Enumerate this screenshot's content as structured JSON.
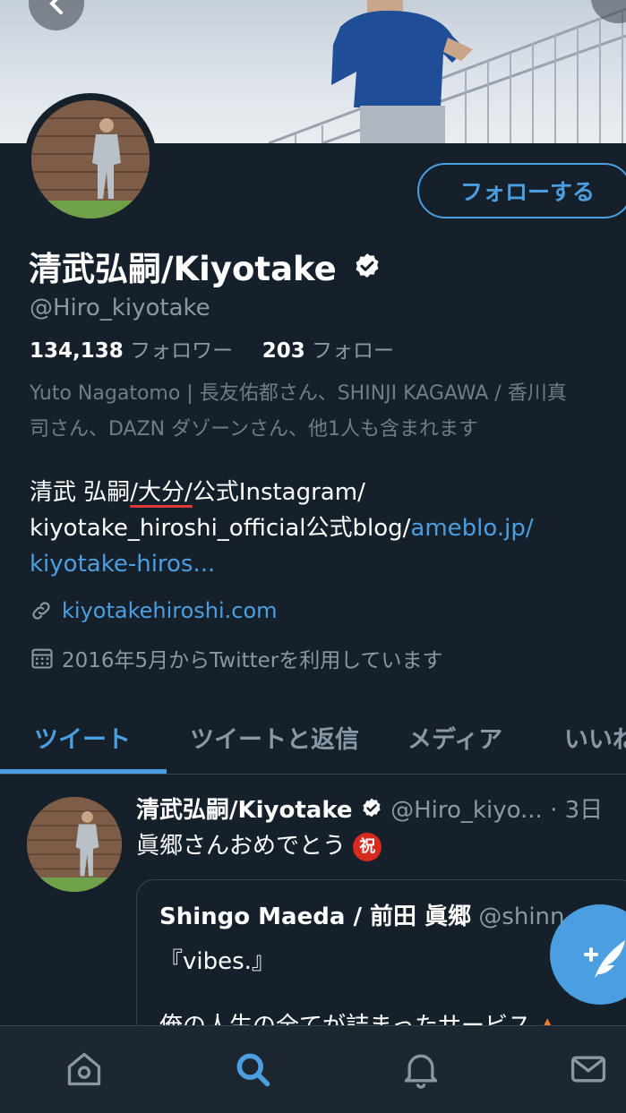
{
  "profile": {
    "display_name": "清武弘嗣/Kiyotake",
    "handle": "@Hiro_kiyotake",
    "followers_count": "134,138",
    "followers_label": "フォロワー",
    "following_count": "203",
    "following_label": "フォロー",
    "mutual_line1": "Yuto Nagatomo | 長友佑都さん、SHINJI KAGAWA / 香川真",
    "mutual_line2": "司さん、DAZN ダゾーンさん、他1人も含まれます",
    "bio_part1": "清武 弘嗣",
    "bio_part2": "/大分/",
    "bio_part3": "公式Instagram/",
    "bio_line2_text": "kiyotake_hiroshi_official公式blog/",
    "bio_line2_link": "ameblo.jp/",
    "bio_line3_link": "kiyotake-hiros...",
    "website": "kiyotakehiroshi.com",
    "joined": "2016年5月からTwitterを利用しています",
    "follow_button": "フォローする"
  },
  "tabs": [
    {
      "label": "ツイート",
      "active": true
    },
    {
      "label": "ツイートと返信",
      "active": false
    },
    {
      "label": "メディア",
      "active": false
    },
    {
      "label": "いいね",
      "active": false
    }
  ],
  "tweet": {
    "name": "清武弘嗣/Kiyotake",
    "meta": "@Hiro_kiyo... · 3日",
    "text": "眞郷さんおめでとう",
    "emoji": "祝",
    "quote": {
      "name": "Shingo Maeda / 前田 眞郷",
      "handle": "@shinn",
      "line1": "『vibes.』",
      "line2": "俺の人生の全てが詰まったサービス"
    }
  },
  "colors": {
    "background": "#15202b",
    "accent": "#4b9fe1",
    "muted": "#8899a6",
    "border": "#38444d"
  },
  "icons": {
    "nav": [
      "home-icon",
      "search-icon",
      "notifications-icon",
      "messages-icon"
    ],
    "fab": "compose-tweet-icon"
  }
}
